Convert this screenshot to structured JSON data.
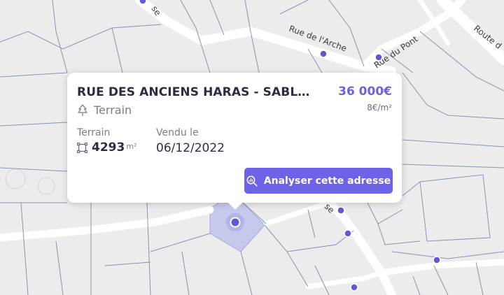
{
  "map": {
    "streets": {
      "rue_de_l_arche": "Rue de l'Arche",
      "rue_du_pont": "Rue du Pont",
      "route_partial": "Route d",
      "partial_top": "se",
      "partial_mid": "se"
    },
    "colors": {
      "background": "#ececed",
      "road": "#ffffff",
      "parcel_line": "#8a92b0",
      "marker": "#5b5bd6",
      "selected_parcel": "#c6c8ec"
    }
  },
  "popup": {
    "address": "RUE DES ANCIENS HARAS - SABLÉ-SUR-SARTHE",
    "price": "36 000€",
    "price_per_m2": "8€/m²",
    "type_icon": "tree-icon",
    "type": "Terrain",
    "surface_label": "Terrain",
    "surface_value": "4293",
    "surface_unit": "m²",
    "sold_label": "Vendu le",
    "sold_date": "06/12/2022",
    "analyse_button": "Analyser cette adresse",
    "accent_color": "#6c63e6"
  }
}
